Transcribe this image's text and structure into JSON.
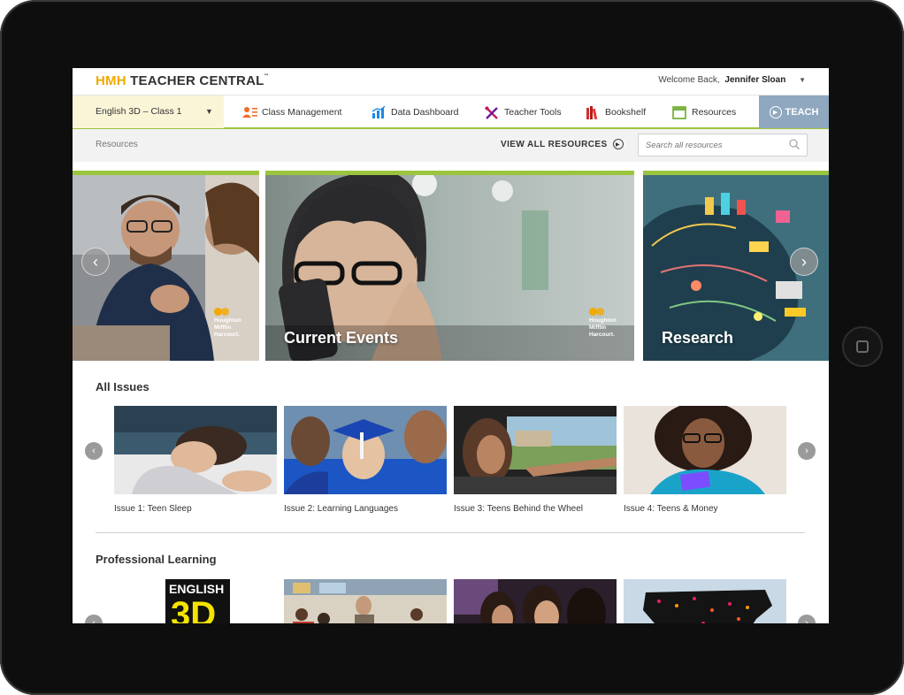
{
  "header": {
    "logo_hmh": "HMH",
    "logo_rest": "TEACHER CENTRAL",
    "logo_tm": "™",
    "welcome_text": "Welcome Back,",
    "user_name": "Jennifer Sloan"
  },
  "nav": {
    "class_select": "English 3D – Class 1",
    "items": [
      {
        "label": "Class Management",
        "icon": "class-management-icon"
      },
      {
        "label": "Data Dashboard",
        "icon": "data-dashboard-icon"
      },
      {
        "label": "Teacher Tools",
        "icon": "teacher-tools-icon"
      },
      {
        "label": "Bookshelf",
        "icon": "bookshelf-icon"
      },
      {
        "label": "Resources",
        "icon": "resources-icon",
        "active": true
      }
    ],
    "teach_label": "TEACH"
  },
  "subbar": {
    "breadcrumb": "Resources",
    "view_all": "VIEW ALL RESOURCES",
    "search_placeholder": "Search all resources"
  },
  "hero": {
    "banners": [
      {
        "title": "",
        "brand": [
          "Houghton",
          "Mifflin",
          "Harcourt."
        ]
      },
      {
        "title": "Current Events",
        "brand": [
          "Houghton",
          "Mifflin",
          "Harcourt."
        ]
      },
      {
        "title": "Research"
      }
    ]
  },
  "all_issues": {
    "title": "All Issues",
    "cards": [
      {
        "caption": "Issue 1: Teen Sleep"
      },
      {
        "caption": "Issue 2: Learning Languages"
      },
      {
        "caption": "Issue 3: Teens Behind the Wheel"
      },
      {
        "caption": "Issue 4: Teens & Money"
      }
    ]
  },
  "professional_learning": {
    "title": "Professional Learning",
    "book_text": "ENGLISH",
    "book_big": "3D"
  },
  "colors": {
    "accent_green": "#9bc53d",
    "brand_orange": "#f2a900",
    "teach_blue": "#8fa8bf",
    "class_select_bg": "#fbf5d8"
  }
}
